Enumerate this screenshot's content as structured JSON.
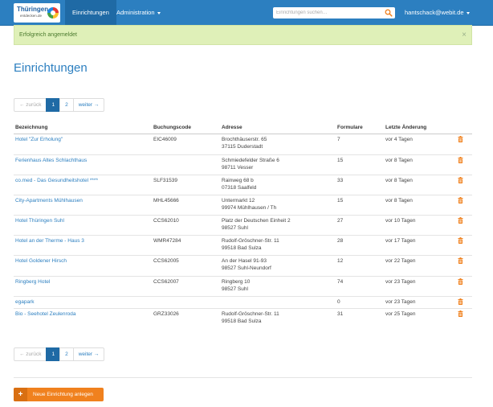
{
  "brand": {
    "name": "Thüringen",
    "tagline": "entdecken.de",
    "logo_icon": "rainbow-circle-logo"
  },
  "nav": {
    "active_item": "Einrichtungen",
    "admin_item": "Administration",
    "search_placeholder": "Einrichtungen suchen…",
    "user": "hantschack@webit.de"
  },
  "alert": {
    "message": "Erfolgreich angemeldet",
    "close": "×"
  },
  "page_title": "Einrichtungen",
  "pagination": {
    "prev": "← zurück",
    "pages": [
      "1",
      "2"
    ],
    "active_page": "1",
    "next": "weiter →"
  },
  "table": {
    "headers": [
      "Bezeichnung",
      "Buchungscode",
      "Adresse",
      "Formulare",
      "Letzte Änderung",
      ""
    ],
    "rows": [
      {
        "name": "Hotel \"Zur Erholung\"",
        "code": "EIC46009",
        "addr1": "Brochthäuserstr. 65",
        "addr2": "37115 Duderstadt",
        "forms": "7",
        "changed": "vor 4 Tagen"
      },
      {
        "name": "Ferienhaus Altes Schlachthaus",
        "code": "",
        "addr1": "Schmiedefelder Straße 6",
        "addr2": "98711 Vesser",
        "forms": "15",
        "changed": "vor 8 Tagen"
      },
      {
        "name": "co.med - Das Gesundheitshotel ****",
        "code": "SLF31539",
        "addr1": "Rainweg 68 b",
        "addr2": "07318 Saalfeld",
        "forms": "33",
        "changed": "vor 8 Tagen"
      },
      {
        "name": "City-Apartments Mühlhausen",
        "code": "MHL45666",
        "addr1": "Untermarkt 12",
        "addr2": "99974 Mühlhausen / Th",
        "forms": "15",
        "changed": "vor 8 Tagen"
      },
      {
        "name": "Hotel Thüringen Suhl",
        "code": "CCS62010",
        "addr1": "Platz der Deutschen Einheit 2",
        "addr2": "98527 Suhl",
        "forms": "27",
        "changed": "vor 10 Tagen"
      },
      {
        "name": "Hotel an der Therme - Haus 3",
        "code": "WMR47284",
        "addr1": "Rudolf-Gröschner-Str. 11",
        "addr2": "99518 Bad Sulza",
        "forms": "28",
        "changed": "vor 17 Tagen"
      },
      {
        "name": "Hotel Goldener Hirsch",
        "code": "CCS62005",
        "addr1": "An der Hasel 91-93",
        "addr2": "98527 Suhl-Neundorf",
        "forms": "12",
        "changed": "vor 22 Tagen"
      },
      {
        "name": "Ringberg Hotel",
        "code": "CCS62007",
        "addr1": "Ringberg 10",
        "addr2": "98527 Suhl",
        "forms": "74",
        "changed": "vor 23 Tagen"
      },
      {
        "name": "egapark",
        "code": "",
        "addr1": "",
        "addr2": "",
        "forms": "0",
        "changed": "vor 23 Tagen"
      },
      {
        "name": "Bio - Seehotel Zeulenroda",
        "code": "GRZ33026",
        "addr1": "Rudolf-Gröschner-Str. 11",
        "addr2": "99518 Bad Sulza",
        "forms": "31",
        "changed": "vor 25 Tagen"
      }
    ]
  },
  "new_button": {
    "icon": "plus-icon",
    "plus": "+",
    "label": "Neue Einrichtung anlegen"
  },
  "colors": {
    "primary": "#2c7fc0",
    "nav_active": "#1f6aa5",
    "success_bg": "#dff0b8",
    "accent_orange": "#f0811e"
  }
}
